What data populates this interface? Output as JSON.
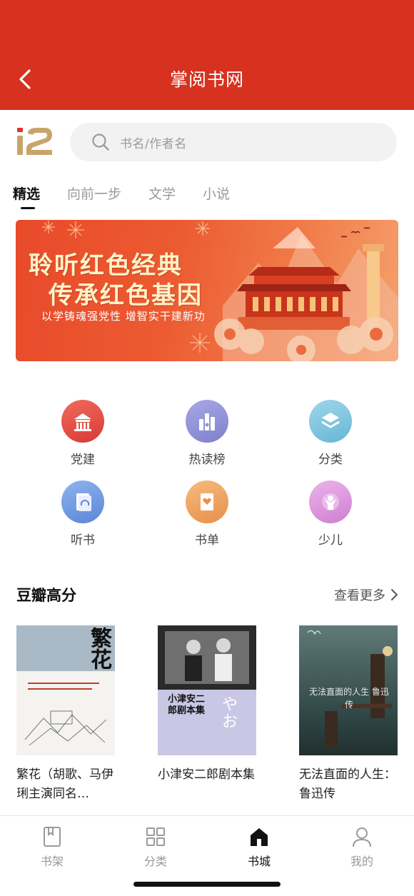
{
  "header": {
    "title": "掌阅书网"
  },
  "search": {
    "placeholder": "书名/作者名"
  },
  "tabs": [
    {
      "label": "精选",
      "active": true
    },
    {
      "label": "向前一步",
      "active": false
    },
    {
      "label": "文学",
      "active": false
    },
    {
      "label": "小说",
      "active": false
    }
  ],
  "banner": {
    "line1": "聆听红色经典",
    "line2": "传承红色基因",
    "subtitle": "以学铸魂强党性 增智实干建新功"
  },
  "features": [
    {
      "label": "党建",
      "icon": "building-icon",
      "color": "#e0453d"
    },
    {
      "label": "热读榜",
      "icon": "chart-icon",
      "color": "#8e8fd6"
    },
    {
      "label": "分类",
      "icon": "layers-icon",
      "color": "#7fc6e0"
    },
    {
      "label": "听书",
      "icon": "headphones-icon",
      "color": "#6e9ae0"
    },
    {
      "label": "书单",
      "icon": "heart-card-icon",
      "color": "#ee9f5e"
    },
    {
      "label": "少儿",
      "icon": "child-icon",
      "color": "#da8fd8"
    }
  ],
  "section": {
    "title": "豆瓣高分",
    "more": "查看更多"
  },
  "books": [
    {
      "title": "繁花（胡歌、马伊琍主演同名…",
      "cover_text": "繁花"
    },
    {
      "title": "小津安二郎剧本集",
      "cover_text": "小津安二郎剧本集"
    },
    {
      "title": "无法直面的人生：鲁迅传",
      "cover_text": "无法直面的人生 鲁迅传"
    }
  ],
  "tabbar": [
    {
      "label": "书架",
      "icon": "bookshelf-icon",
      "active": false
    },
    {
      "label": "分类",
      "icon": "grid-icon",
      "active": false
    },
    {
      "label": "书城",
      "icon": "home-icon",
      "active": true
    },
    {
      "label": "我的",
      "icon": "user-icon",
      "active": false
    }
  ],
  "colors": {
    "brand": "#d7321f"
  }
}
